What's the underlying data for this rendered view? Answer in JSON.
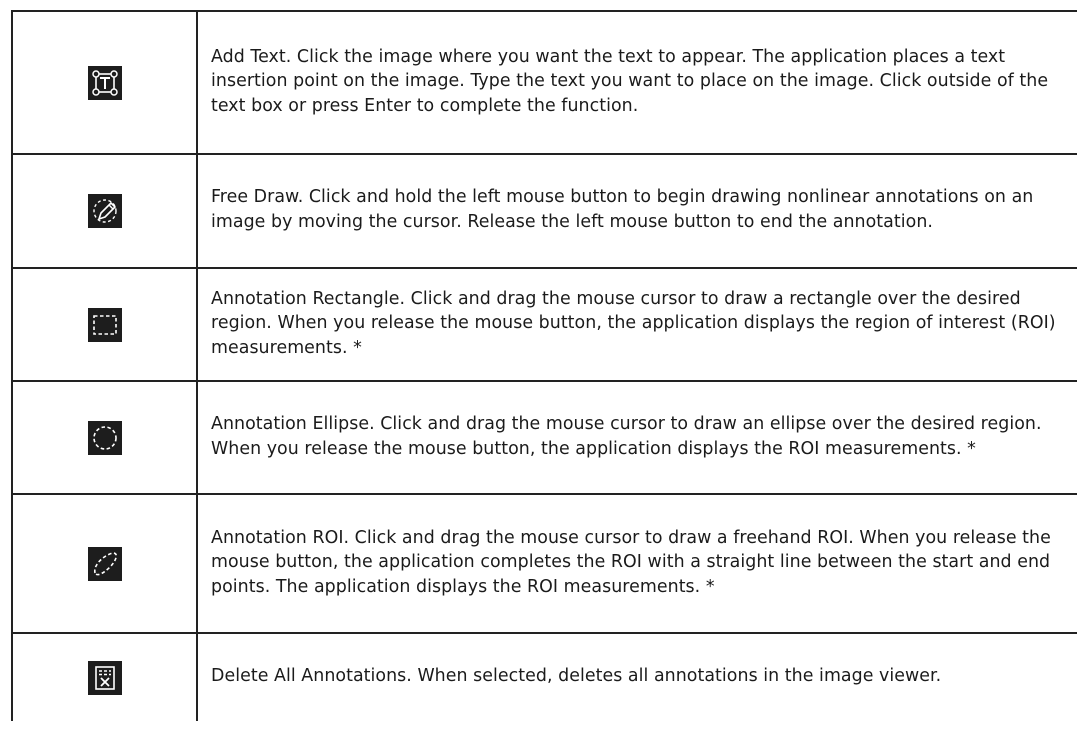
{
  "rows": [
    {
      "icon": "text-box-icon",
      "description": "Add Text. Click the image where you want the text to appear. The application places a text insertion point on the image. Type the text you want to place on the image. Click outside of the text box or press Enter to complete the function."
    },
    {
      "icon": "free-draw-pencil-icon",
      "description": "Free Draw. Click and hold the left mouse button to begin drawing nonlinear annotations on an image by moving the cursor. Release the left mouse button to end the annotation."
    },
    {
      "icon": "dashed-rectangle-icon",
      "description": "Annotation Rectangle. Click and drag the mouse cursor to draw a rectangle over the desired region. When you release the mouse button, the application displays the region of interest (ROI) measurements. *"
    },
    {
      "icon": "dashed-ellipse-icon",
      "description": "Annotation Ellipse. Click and drag the mouse cursor to draw an ellipse over the desired region. When you release the mouse button, the application displays the ROI measurements. *"
    },
    {
      "icon": "dashed-freehand-roi-icon",
      "description": "Annotation ROI. Click and drag the mouse cursor to draw a freehand ROI. When you release the mouse button, the application completes the ROI with a straight line between the start and end points. The application displays the ROI measurements. *"
    },
    {
      "icon": "delete-annotations-icon",
      "description": "Delete All Annotations. When selected, deletes all annotations in the image viewer."
    }
  ]
}
